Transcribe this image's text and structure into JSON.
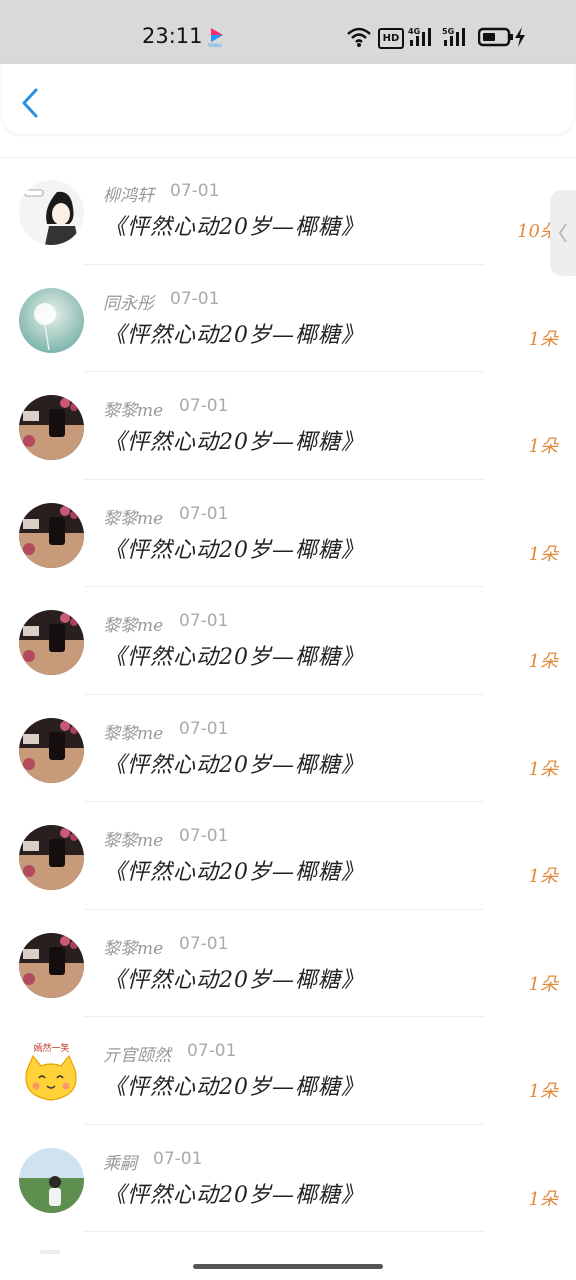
{
  "status_bar": {
    "time": "23:11",
    "app_icon": "youku-logo",
    "icons": [
      "wifi-icon",
      "hd-icon",
      "4g-signal-icon",
      "5g-signal-icon",
      "battery-icon",
      "charging-bolt-icon"
    ],
    "hd_label": "HD",
    "net1_label": "4G",
    "net2_label": "5G"
  },
  "header": {
    "back_icon": "chevron-left-icon",
    "accent_color": "#2b8fe0"
  },
  "side_tab": {
    "icon": "chevron-left-icon"
  },
  "colors": {
    "name": "#999999",
    "message": "#222222",
    "count": "#e08a3c"
  },
  "rows": [
    {
      "name": "柳鸿轩",
      "date": "07-01",
      "message": "《怦然心动20岁—椰糖》",
      "count": "10朵",
      "avatar": "cartoon-girl-avatar"
    },
    {
      "name": "同永彤",
      "date": "07-01",
      "message": "《怦然心动20岁—椰糖》",
      "count": "1朵",
      "avatar": "dandelion-avatar"
    },
    {
      "name": "黎黎me",
      "date": "07-01",
      "message": "《怦然心动20岁—椰糖》",
      "count": "1朵",
      "avatar": "selfie-avatar"
    },
    {
      "name": "黎黎me",
      "date": "07-01",
      "message": "《怦然心动20岁—椰糖》",
      "count": "1朵",
      "avatar": "selfie-avatar"
    },
    {
      "name": "黎黎me",
      "date": "07-01",
      "message": "《怦然心动20岁—椰糖》",
      "count": "1朵",
      "avatar": "selfie-avatar"
    },
    {
      "name": "黎黎me",
      "date": "07-01",
      "message": "《怦然心动20岁—椰糖》",
      "count": "1朵",
      "avatar": "selfie-avatar"
    },
    {
      "name": "黎黎me",
      "date": "07-01",
      "message": "《怦然心动20岁—椰糖》",
      "count": "1朵",
      "avatar": "selfie-avatar"
    },
    {
      "name": "黎黎me",
      "date": "07-01",
      "message": "《怦然心动20岁—椰糖》",
      "count": "1朵",
      "avatar": "selfie-avatar"
    },
    {
      "name": "亓官颐然",
      "date": "07-01",
      "message": "《怦然心动20岁—椰糖》",
      "count": "1朵",
      "avatar": "cartoon-cat-avatar",
      "avatar_text": "嫣然一笑"
    },
    {
      "name": "乘嗣",
      "date": "07-01",
      "message": "《怦然心动20岁—椰糖》",
      "count": "1朵",
      "avatar": "outdoor-photo-avatar"
    }
  ]
}
